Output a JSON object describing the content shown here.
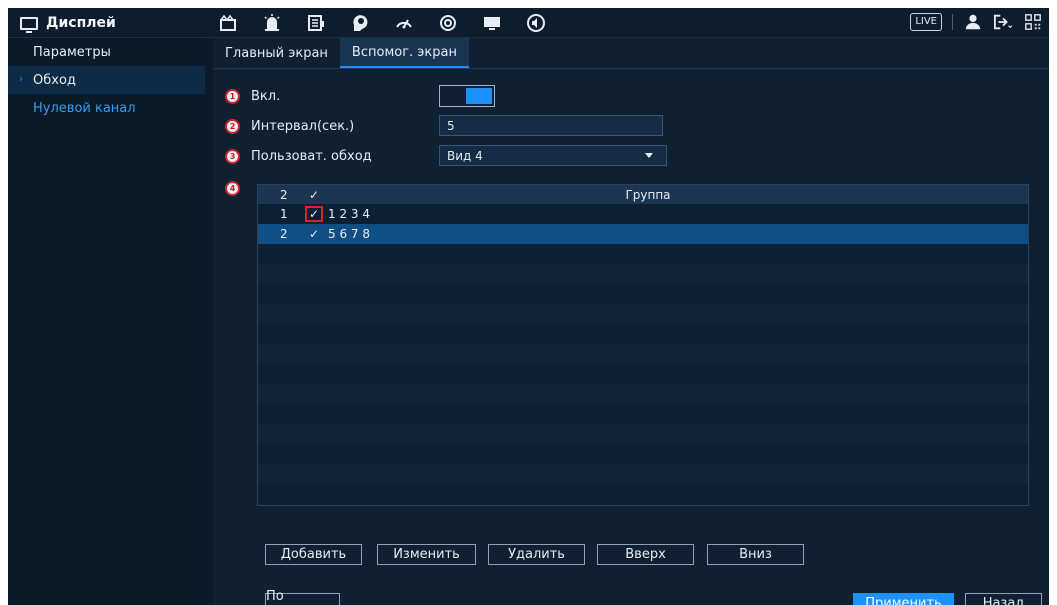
{
  "header": {
    "menu_title": "Дисплей",
    "top_icons": [
      "camera-icon",
      "alarm-icon",
      "storage-icon",
      "ai-icon",
      "network-icon",
      "system-icon",
      "display-icon",
      "audio-icon"
    ],
    "live_label": "LIVE"
  },
  "sidebar": {
    "items": [
      {
        "label": "Параметры"
      },
      {
        "label": "Обход"
      },
      {
        "label": "Нулевой канал"
      }
    ]
  },
  "tabs": [
    {
      "label": "Главный экран"
    },
    {
      "label": "Вспомог. экран"
    }
  ],
  "form": {
    "enable": {
      "badge": "1",
      "label": "Вкл.",
      "on": true
    },
    "interval": {
      "badge": "2",
      "label": "Интервал(сек.)",
      "value": "5"
    },
    "custom_tour": {
      "badge": "3",
      "label": "Пользоват. обход",
      "value": "Вид 4"
    },
    "table_badge": "4"
  },
  "table": {
    "header": {
      "count": "2",
      "check": "✓",
      "group": "Группа"
    },
    "rows": [
      {
        "num": "1",
        "check": "✓",
        "group": "1 2 3 4"
      },
      {
        "num": "2",
        "check": "✓",
        "group": "5 6 7 8"
      }
    ]
  },
  "buttons": {
    "add": "Добавить",
    "edit": "Изменить",
    "delete": "Удалить",
    "up": "Вверх",
    "down": "Вниз",
    "default": "По умолч...",
    "apply": "Применить",
    "back": "Назад"
  },
  "colors": {
    "accent": "#1e90ff",
    "highlight": "#e02027"
  }
}
